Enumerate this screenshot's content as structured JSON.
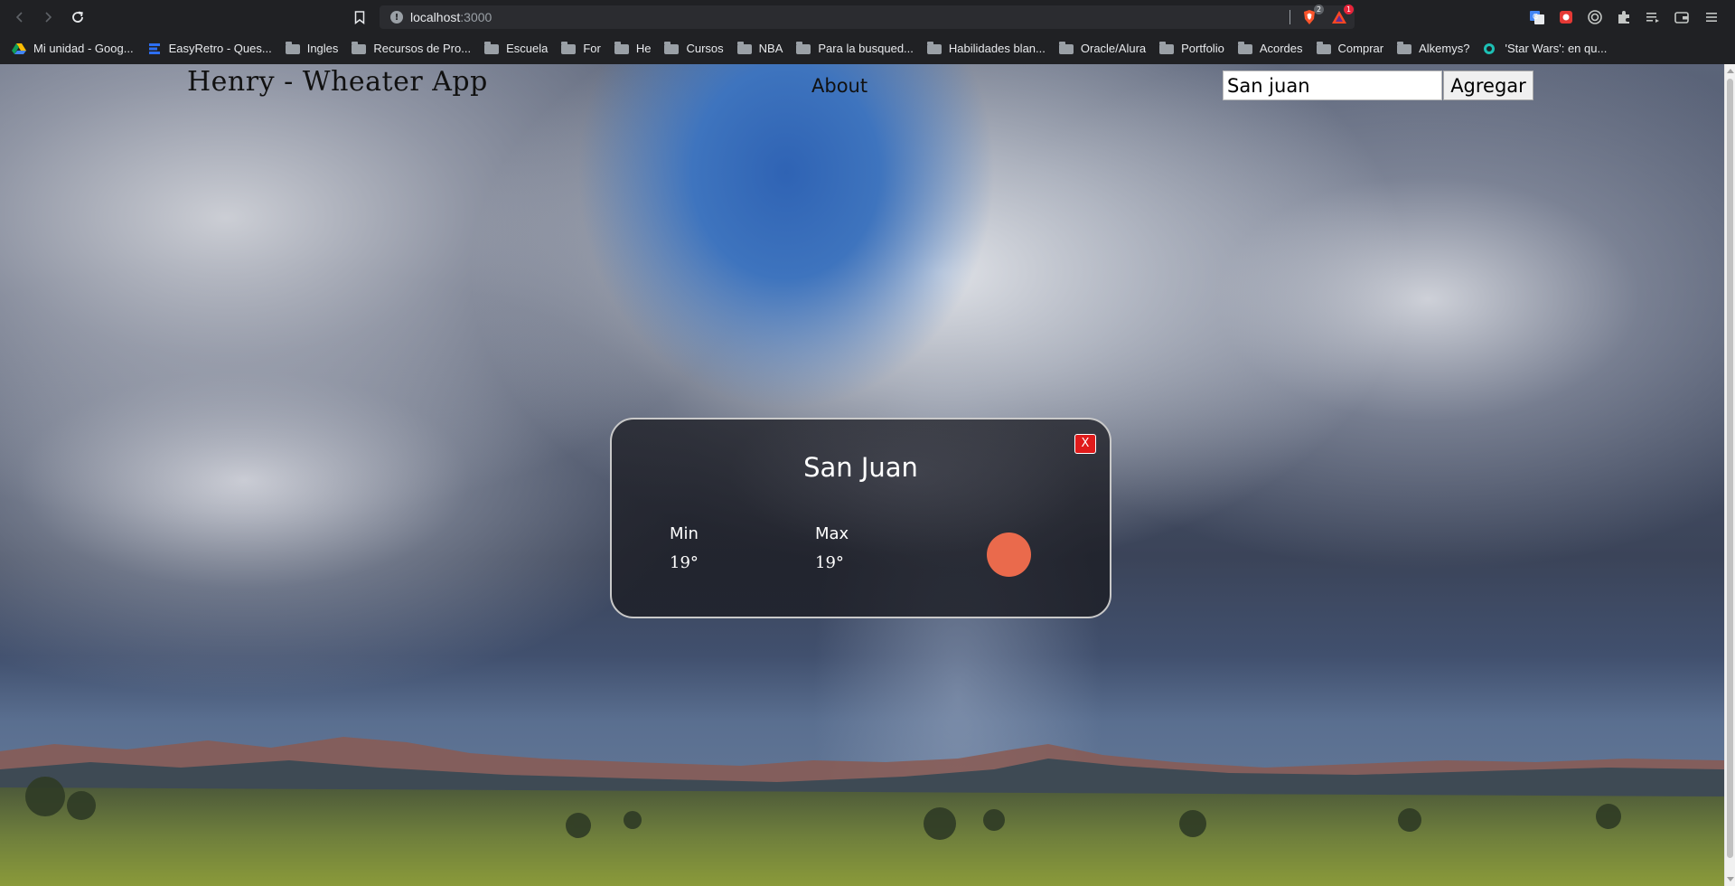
{
  "browser": {
    "url_host": "localhost",
    "url_port": ":3000",
    "extensions": [
      {
        "name": "brave-shield-icon",
        "badge": "2",
        "color": "#fb542b",
        "badge_color": "#5f6368"
      },
      {
        "name": "brave-rewards-icon",
        "badge": "1",
        "color": "#ff4724",
        "badge_color": "#e8243a"
      }
    ],
    "bookmarks": [
      {
        "label": "Mi unidad - Goog...",
        "icon": "google-drive-icon"
      },
      {
        "label": "EasyRetro - Ques...",
        "icon": "easyretro-icon"
      },
      {
        "label": "Ingles",
        "icon": "folder-icon"
      },
      {
        "label": "Recursos de Pro...",
        "icon": "folder-icon"
      },
      {
        "label": "Escuela",
        "icon": "folder-icon"
      },
      {
        "label": "For",
        "icon": "folder-icon"
      },
      {
        "label": "He",
        "icon": "folder-icon"
      },
      {
        "label": "Cursos",
        "icon": "folder-icon"
      },
      {
        "label": "NBA",
        "icon": "folder-icon"
      },
      {
        "label": "Para la busqued...",
        "icon": "folder-icon"
      },
      {
        "label": "Habilidades blan...",
        "icon": "folder-icon"
      },
      {
        "label": "Oracle/Alura",
        "icon": "folder-icon"
      },
      {
        "label": "Portfolio",
        "icon": "folder-icon"
      },
      {
        "label": "Acordes",
        "icon": "folder-icon"
      },
      {
        "label": "Comprar",
        "icon": "folder-icon"
      },
      {
        "label": "Alkemys?",
        "icon": "folder-icon"
      },
      {
        "label": "'Star Wars': en qu...",
        "icon": "site-icon"
      }
    ]
  },
  "app": {
    "title": "Henry - Wheater App",
    "nav_about": "About",
    "search": {
      "value": "San juan",
      "button": "Agregar"
    },
    "card": {
      "city": "San Juan",
      "close": "X",
      "min_label": "Min",
      "min_value": "19°",
      "max_label": "Max",
      "max_value": "19°",
      "icon_color": "#ea6a4c",
      "weather_icon": "sun-icon"
    }
  }
}
